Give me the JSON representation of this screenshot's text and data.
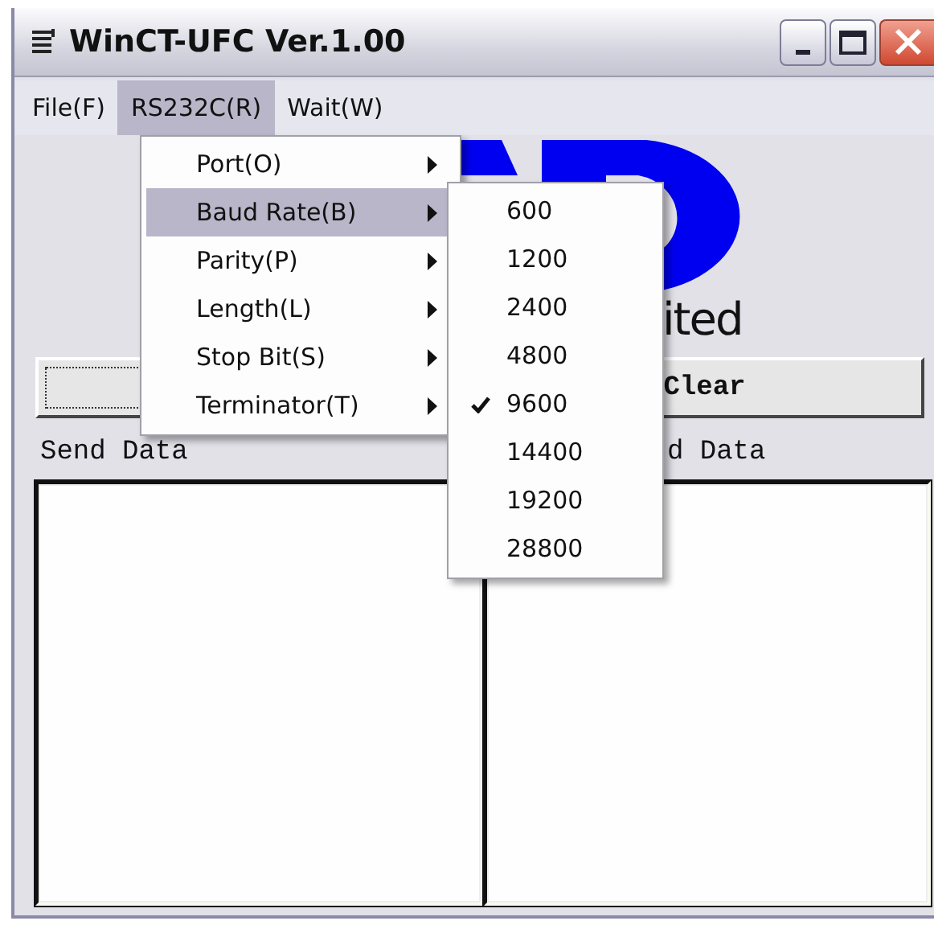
{
  "window": {
    "title": "WinCT-UFC  Ver.1.00"
  },
  "menu_bar": [
    {
      "label": "File(F)",
      "selected": false
    },
    {
      "label": "RS232C(R)",
      "selected": true
    },
    {
      "label": "Wait(W)",
      "selected": false
    }
  ],
  "open_menu": [
    {
      "label": "Port(O)",
      "selected": false
    },
    {
      "label": "Baud Rate(B)",
      "selected": true
    },
    {
      "label": "Parity(P)",
      "selected": false
    },
    {
      "label": "Length(L)",
      "selected": false
    },
    {
      "label": "Stop Bit(S)",
      "selected": false
    },
    {
      "label": "Terminator(T)",
      "selected": false
    }
  ],
  "submenu": [
    {
      "label": "600",
      "checked": false
    },
    {
      "label": "1200",
      "checked": false
    },
    {
      "label": "2400",
      "checked": false
    },
    {
      "label": "4800",
      "checked": false
    },
    {
      "label": "9600",
      "checked": true
    },
    {
      "label": "14400",
      "checked": false
    },
    {
      "label": "19200",
      "checked": false
    },
    {
      "label": "28800",
      "checked": false
    }
  ],
  "logo": {
    "text": "ited"
  },
  "clear_button": {
    "label": "Clear"
  },
  "send_panel": {
    "label": "Send Data"
  },
  "receive_panel": {
    "label": "d Data"
  }
}
